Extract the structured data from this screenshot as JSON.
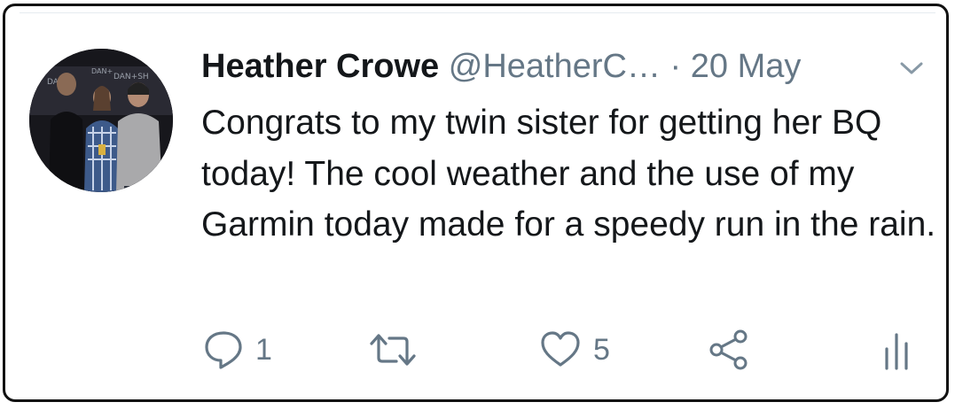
{
  "tweet": {
    "author_name": "Heather Crowe",
    "author_handle": "@HeatherC…",
    "separator": "·",
    "date": "20 May",
    "text": "Congrats to my twin sister for getting her BQ today! The cool weather and the use of my Garmin today made for a speedy run in the rain."
  },
  "actions": {
    "reply_count": "1",
    "retweet_count": "",
    "like_count": "5"
  },
  "icons": {
    "more": "chevron-down-icon",
    "reply": "reply-icon",
    "retweet": "retweet-icon",
    "like": "heart-icon",
    "share": "share-icon",
    "analytics": "analytics-icon"
  },
  "colors": {
    "name_text": "#14171a",
    "muted_text": "#657786",
    "background": "#ffffff"
  }
}
